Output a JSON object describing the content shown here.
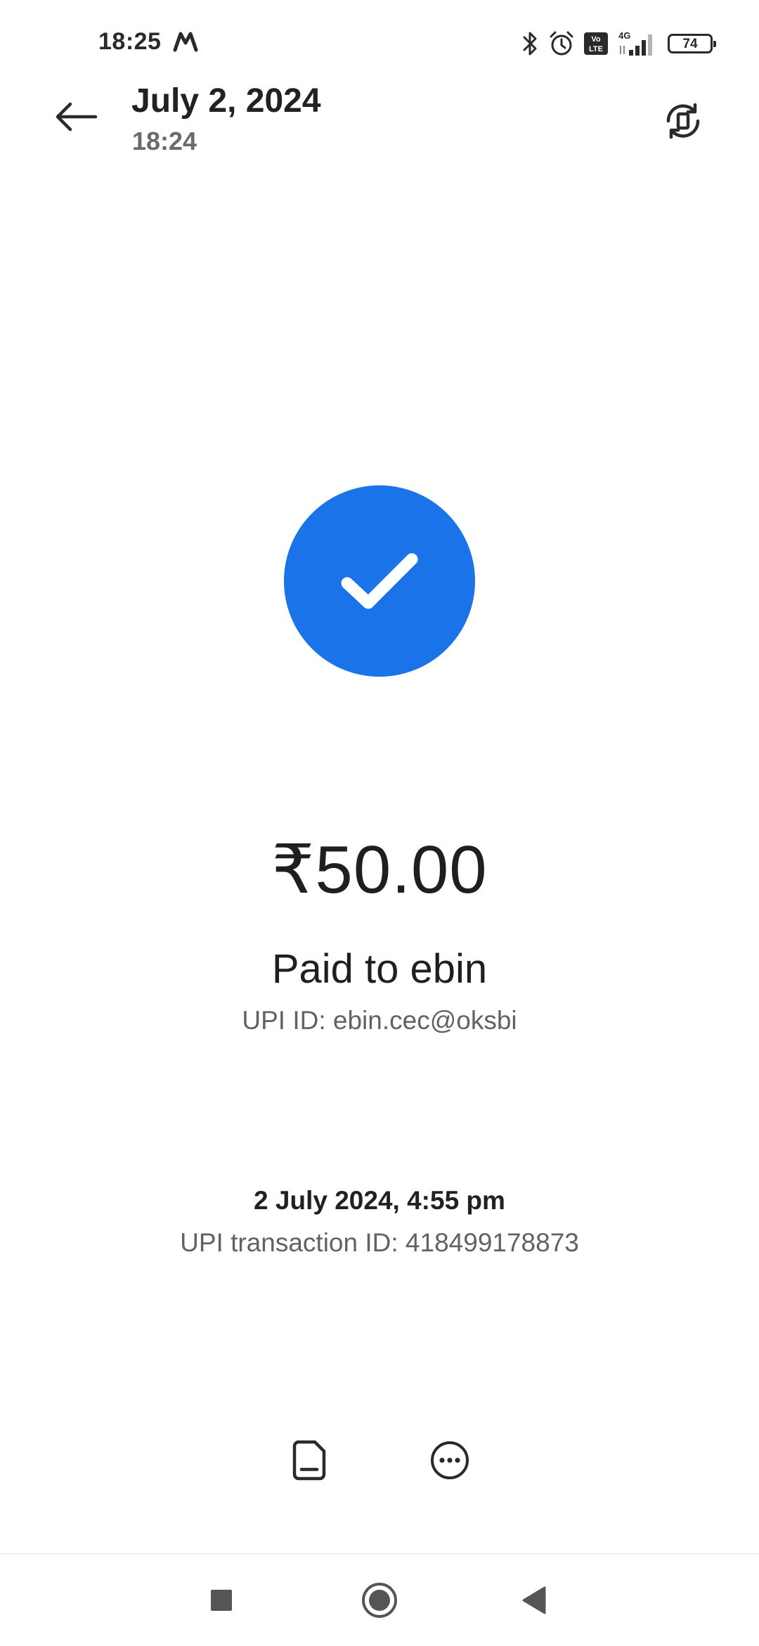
{
  "status_bar": {
    "time": "18:25",
    "left_icon": "m-logo-icon",
    "icons": [
      "bluetooth-icon",
      "alarm-icon",
      "volte-icon",
      "signal-4g-icon"
    ],
    "volte_text": "Vo LTE",
    "network_label": "4G",
    "battery_level": "74"
  },
  "header": {
    "title": "July 2, 2024",
    "subtitle": "18:24",
    "back_icon": "arrow-left-icon",
    "action_icon": "rotate-screen-icon"
  },
  "payment": {
    "status_icon": "checkmark-icon",
    "status_color": "#1a73e8",
    "amount": "₹50.00",
    "paid_to": "Paid to ebin",
    "upi_id": "UPI ID: ebin.cec@oksbi",
    "datetime": "2 July 2024, 4:55 pm",
    "transaction_id": "UPI transaction ID: 418499178873"
  },
  "actions": {
    "icons": [
      "document-icon",
      "more-options-icon"
    ]
  },
  "nav_bar": {
    "icons": [
      "recents-square-icon",
      "home-circle-icon",
      "back-triangle-icon"
    ]
  }
}
